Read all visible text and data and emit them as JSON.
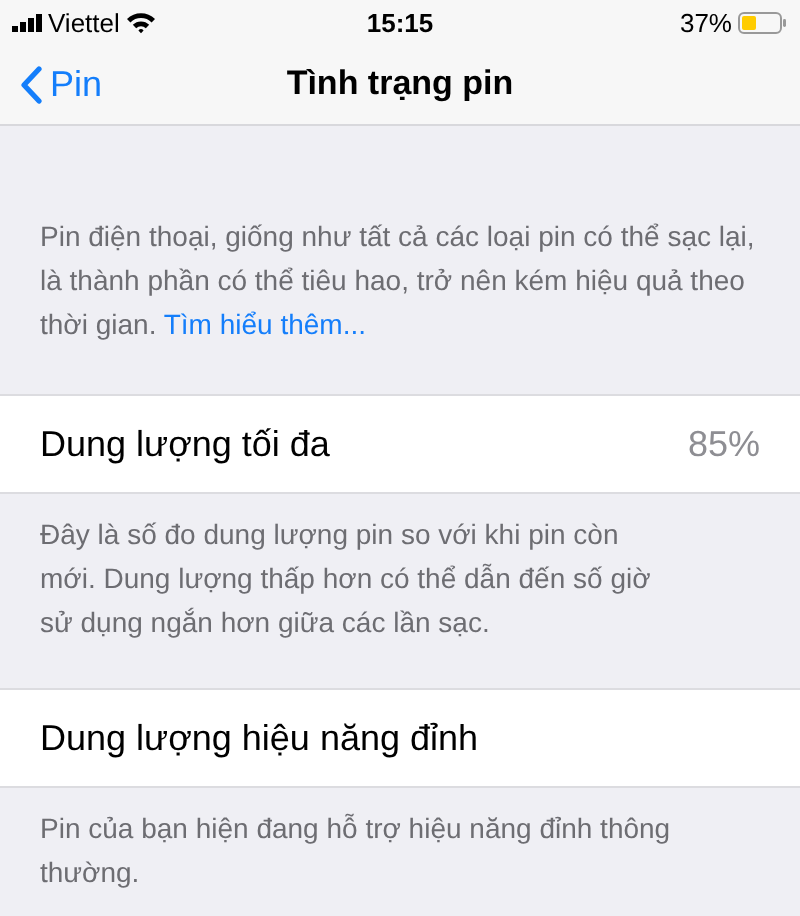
{
  "status_bar": {
    "carrier": "Viettel",
    "time": "15:15",
    "battery_percent": "37%"
  },
  "nav_bar": {
    "back": "Pin",
    "title": "Tình trạng pin"
  },
  "intro": {
    "text": "Pin điện thoại, giống như tất cả các loại pin có thể sạc lại, là thành phần có thể tiêu hao, trở nên kém hiệu quả theo thời gian.",
    "link": "Tìm hiểu thêm..."
  },
  "sections": [
    {
      "label": "Dung lượng tối đa",
      "value": "85%",
      "footer": "Đây là số đo dung lượng pin so với khi pin còn mới. Dung lượng thấp hơn có thể dẫn đến số giờ sử dụng ngắn hơn giữa các lần sạc."
    },
    {
      "label": "Dung lượng hiệu năng đỉnh",
      "footer": "Pin của bạn hiện đang hỗ trợ hiệu năng đỉnh thông thường."
    }
  ]
}
